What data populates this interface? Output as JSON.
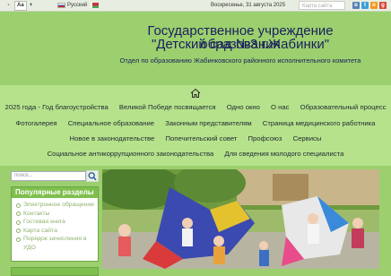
{
  "topbar": {
    "font_minus": "-",
    "font_normal": "Aa",
    "font_plus": "+",
    "language": "Русский",
    "date": "Воскресенье, 31 августа 2025",
    "site_map": "Карта сайта"
  },
  "header": {
    "title_line1": "Государственное учреждение образования",
    "title_line2": "\"Детский сад №3 г.Жабинки\"",
    "subtitle": "Отдел по  образованию Жабинковского районного исполнительного комитета"
  },
  "nav": {
    "row1": [
      "2025 года - Год благоустройства",
      "Великой Победе посвящается",
      "Одно окно",
      "О нас",
      "Образовательный процесс"
    ],
    "row2": [
      "Фотогалерея",
      "Специальное образование",
      "Законным представителям",
      "Страница медицинского работника"
    ],
    "row3": [
      "Новое в законодательстве",
      "Попечительский совет",
      "Профсоюз",
      "Сервисы"
    ],
    "row4": [
      "Социальное антикоррупционного законодательства",
      "Для сведения молодого специалиста"
    ]
  },
  "sidebar": {
    "search_placeholder": "поиск...",
    "panel_title": "Популярные разделы",
    "items": [
      "Электронное обращение",
      "Контакты",
      "Гостевая книга",
      "Карта сайта",
      "Порядок зачисления в УДО"
    ]
  },
  "colors": {
    "header_bg": "#9ccf6e",
    "nav_bg": "#b6e28c",
    "title": "#1a1f5e",
    "panel_head": "#7fbf4d"
  }
}
